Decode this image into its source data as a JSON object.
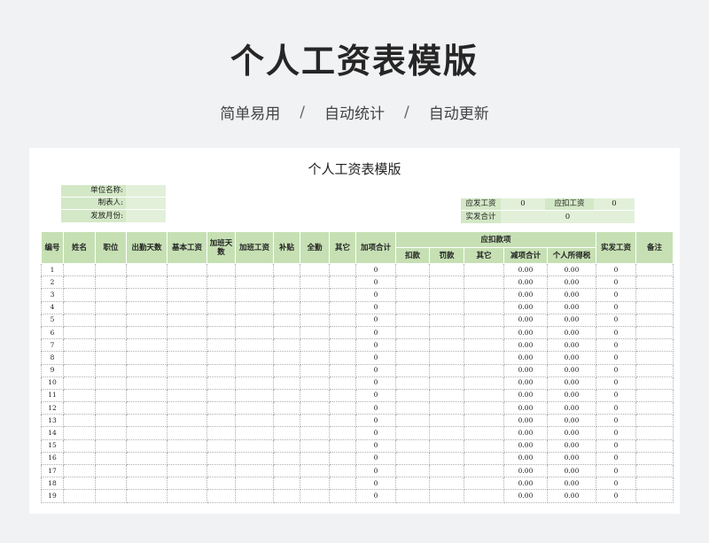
{
  "header": {
    "title": "个人工资表模版",
    "features": [
      "简单易用",
      "自动统计",
      "自动更新"
    ],
    "separator": "/"
  },
  "sheet": {
    "title": "个人工资表模版",
    "info_left": [
      {
        "label": "单位名称:",
        "value": ""
      },
      {
        "label": "制表人:",
        "value": ""
      },
      {
        "label": "发放月份:",
        "value": ""
      }
    ],
    "summary": {
      "gross_label": "应发工资",
      "gross_value": "0",
      "deduct_label": "应扣工资",
      "deduct_value": "0",
      "net_label": "实发合计",
      "net_value": "0"
    },
    "columns": {
      "no": "编号",
      "name": "姓名",
      "position": "职位",
      "attendance_days": "出勤天数",
      "base_salary": "基本工资",
      "overtime_days": "加班天数",
      "overtime_pay": "加班工资",
      "allowance": "补贴",
      "full_attendance": "全勤",
      "other": "其它",
      "additions_total": "加项合计",
      "deductions_group": "应扣款项",
      "deduct_items": [
        "扣款",
        "罚款",
        "其它",
        "减项合计",
        "个人所得税"
      ],
      "net_pay": "实发工资",
      "remarks": "备注"
    },
    "rows": [
      {
        "no": "1",
        "additions_total": "0",
        "deductions_total": "0.00",
        "income_tax": "0.00",
        "net_pay": "0"
      },
      {
        "no": "2",
        "additions_total": "0",
        "deductions_total": "0.00",
        "income_tax": "0.00",
        "net_pay": "0"
      },
      {
        "no": "3",
        "additions_total": "0",
        "deductions_total": "0.00",
        "income_tax": "0.00",
        "net_pay": "0"
      },
      {
        "no": "4",
        "additions_total": "0",
        "deductions_total": "0.00",
        "income_tax": "0.00",
        "net_pay": "0"
      },
      {
        "no": "5",
        "additions_total": "0",
        "deductions_total": "0.00",
        "income_tax": "0.00",
        "net_pay": "0"
      },
      {
        "no": "6",
        "additions_total": "0",
        "deductions_total": "0.00",
        "income_tax": "0.00",
        "net_pay": "0"
      },
      {
        "no": "7",
        "additions_total": "0",
        "deductions_total": "0.00",
        "income_tax": "0.00",
        "net_pay": "0"
      },
      {
        "no": "8",
        "additions_total": "0",
        "deductions_total": "0.00",
        "income_tax": "0.00",
        "net_pay": "0"
      },
      {
        "no": "9",
        "additions_total": "0",
        "deductions_total": "0.00",
        "income_tax": "0.00",
        "net_pay": "0"
      },
      {
        "no": "10",
        "additions_total": "0",
        "deductions_total": "0.00",
        "income_tax": "0.00",
        "net_pay": "0"
      },
      {
        "no": "11",
        "additions_total": "0",
        "deductions_total": "0.00",
        "income_tax": "0.00",
        "net_pay": "0"
      },
      {
        "no": "12",
        "additions_total": "0",
        "deductions_total": "0.00",
        "income_tax": "0.00",
        "net_pay": "0"
      },
      {
        "no": "13",
        "additions_total": "0",
        "deductions_total": "0.00",
        "income_tax": "0.00",
        "net_pay": "0"
      },
      {
        "no": "14",
        "additions_total": "0",
        "deductions_total": "0.00",
        "income_tax": "0.00",
        "net_pay": "0"
      },
      {
        "no": "15",
        "additions_total": "0",
        "deductions_total": "0.00",
        "income_tax": "0.00",
        "net_pay": "0"
      },
      {
        "no": "16",
        "additions_total": "0",
        "deductions_total": "0.00",
        "income_tax": "0.00",
        "net_pay": "0"
      },
      {
        "no": "17",
        "additions_total": "0",
        "deductions_total": "0.00",
        "income_tax": "0.00",
        "net_pay": "0"
      },
      {
        "no": "18",
        "additions_total": "0",
        "deductions_total": "0.00",
        "income_tax": "0.00",
        "net_pay": "0"
      },
      {
        "no": "19",
        "additions_total": "0",
        "deductions_total": "0.00",
        "income_tax": "0.00",
        "net_pay": "0"
      }
    ]
  }
}
